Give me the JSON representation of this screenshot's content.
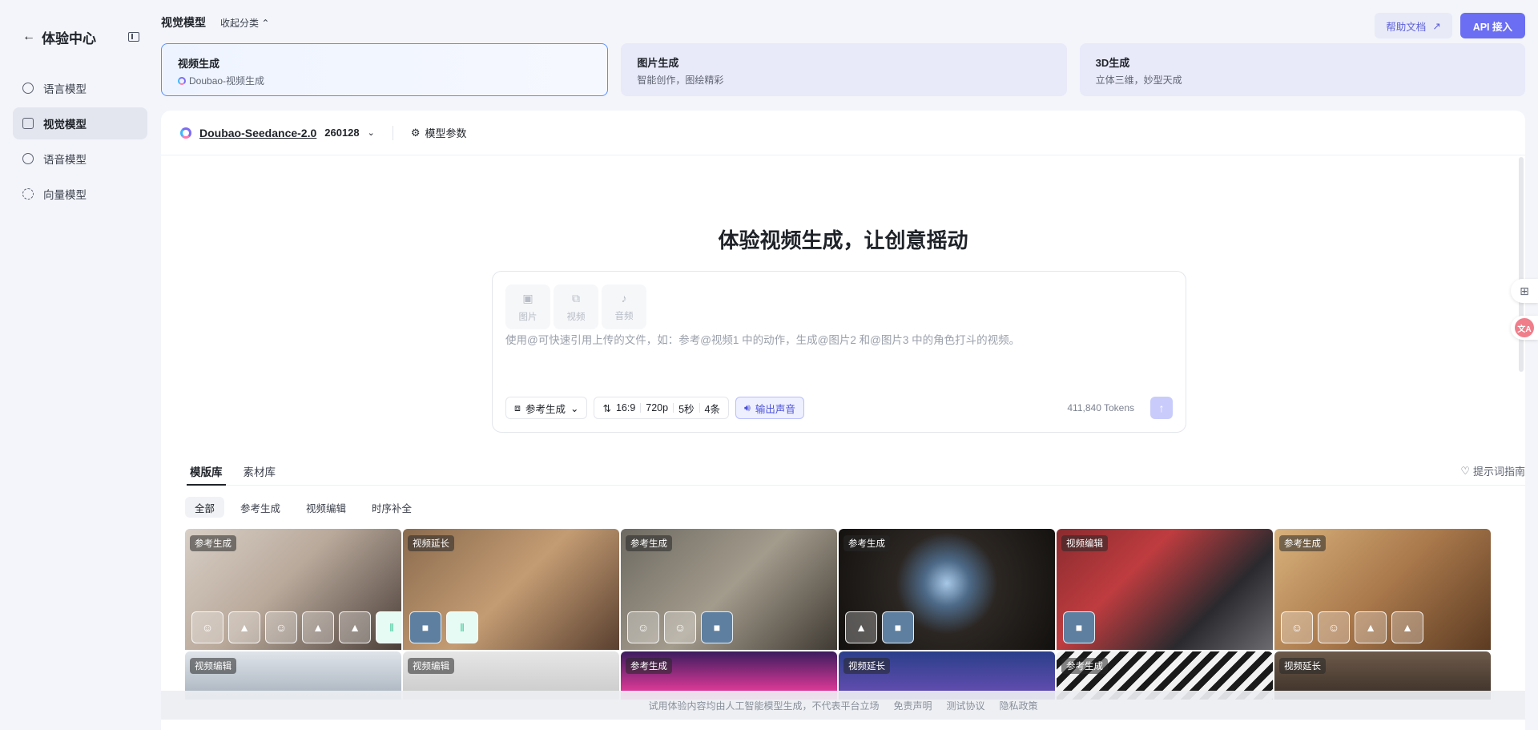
{
  "sidebar": {
    "title": "体验中心",
    "items": [
      {
        "label": "语言模型",
        "active": false
      },
      {
        "label": "视觉模型",
        "active": true
      },
      {
        "label": "语音模型",
        "active": false
      },
      {
        "label": "向量模型",
        "active": false
      }
    ]
  },
  "header": {
    "section_title": "视觉模型",
    "collapse_label": "收起分类",
    "help_label": "帮助文档",
    "api_label": "API 接入"
  },
  "cards": [
    {
      "title": "视频生成",
      "desc": "Doubao-视频生成",
      "active": true
    },
    {
      "title": "图片生成",
      "desc": "智能创作，图绘精彩",
      "active": false
    },
    {
      "title": "3D生成",
      "desc": "立体三维，妙型天成",
      "active": false
    }
  ],
  "model": {
    "name": "Doubao-Seedance-2.0",
    "version": "260128",
    "params_label": "模型参数"
  },
  "hero": "体验视频生成，让创意摇动",
  "composer": {
    "attachments": [
      "图片",
      "视频",
      "音频"
    ],
    "placeholder": "使用@可快速引用上传的文件，如：参考@视频1 中的动作，生成@图片2 和@图片3 中的角色打斗的视频。",
    "mode_label": "参考生成",
    "ratio": "16:9",
    "resolution": "720p",
    "duration": "5秒",
    "count": "4条",
    "audio_label": "输出声音",
    "tokens": "411,840 Tokens"
  },
  "library": {
    "tabs": [
      {
        "label": "模版库",
        "active": true
      },
      {
        "label": "素材库",
        "active": false
      }
    ],
    "guide_label": "提示词指南",
    "filters": [
      {
        "label": "全部",
        "active": true
      },
      {
        "label": "参考生成",
        "active": false
      },
      {
        "label": "视频编辑",
        "active": false
      },
      {
        "label": "时序补全",
        "active": false
      }
    ],
    "tiles_row1": [
      {
        "tag": "参考生成",
        "style": "g1",
        "thumbs": [
          "person",
          "image",
          "person",
          "image",
          "image",
          "audio"
        ]
      },
      {
        "tag": "视频延长",
        "style": "g2",
        "thumbs": [
          "video",
          "audio"
        ]
      },
      {
        "tag": "参考生成",
        "style": "g3",
        "thumbs": [
          "person",
          "person",
          "video"
        ]
      },
      {
        "tag": "参考生成",
        "style": "g4",
        "thumbs": [
          "image",
          "video"
        ]
      },
      {
        "tag": "视频编辑",
        "style": "g5",
        "thumbs": [
          "video"
        ]
      },
      {
        "tag": "参考生成",
        "style": "g6",
        "thumbs": [
          "person",
          "person",
          "image",
          "image"
        ]
      }
    ],
    "tiles_row2": [
      {
        "tag": "视频编辑",
        "style": "h1"
      },
      {
        "tag": "视频编辑",
        "style": "h2"
      },
      {
        "tag": "参考生成",
        "style": "h3"
      },
      {
        "tag": "视频延长",
        "style": "h4"
      },
      {
        "tag": "参考生成",
        "style": "h5"
      },
      {
        "tag": "视频延长",
        "style": "h6"
      }
    ]
  },
  "footer": {
    "disclaimer": "试用体验内容均由人工智能模型生成，不代表平台立场",
    "links": [
      "免责声明",
      "测试协议",
      "隐私政策"
    ]
  },
  "floating": {
    "translate_label": "文A"
  }
}
